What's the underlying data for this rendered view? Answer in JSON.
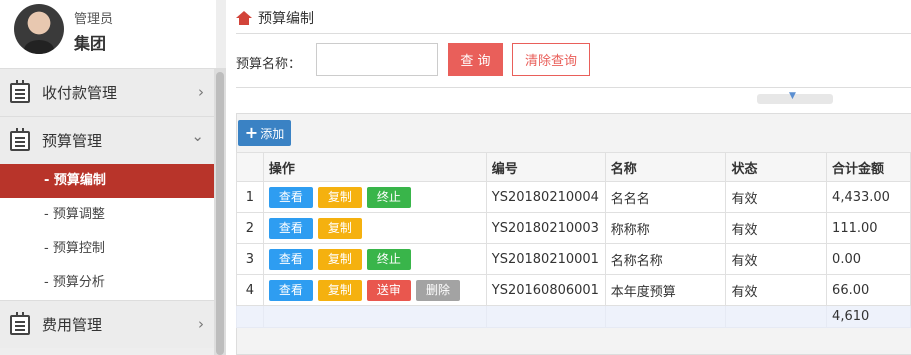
{
  "user": {
    "role": "管理员",
    "org": "集团"
  },
  "sidebar": {
    "groups": [
      {
        "label": "收付款管理",
        "chevron": "›"
      },
      {
        "label": "预算管理",
        "chevron": "⌄"
      },
      {
        "label": "费用管理",
        "chevron": "›"
      }
    ],
    "budget_items": [
      "- 预算编制",
      "- 预算调整",
      "- 预算控制",
      "- 预算分析"
    ],
    "active_item": "- 预算编制"
  },
  "page": {
    "title": "预算编制"
  },
  "search": {
    "label": "预算名称：",
    "value": "",
    "query_button": "查 询",
    "clear_button": "清除查询"
  },
  "toolbar": {
    "add_label": "添加"
  },
  "table": {
    "headers": [
      "操作",
      "编号",
      "名称",
      "状态",
      "合计金额"
    ],
    "rows": [
      {
        "no": "1",
        "actions": [
          "查看",
          "复制",
          "终止"
        ],
        "code": "YS20180210004",
        "name": "名名名",
        "status": "有效",
        "amount": "4,433.00"
      },
      {
        "no": "2",
        "actions": [
          "查看",
          "复制"
        ],
        "code": "YS20180210003",
        "name": "称称称",
        "status": "有效",
        "amount": "111.00"
      },
      {
        "no": "3",
        "actions": [
          "查看",
          "复制",
          "终止"
        ],
        "code": "YS20180210001",
        "name": "名称名称",
        "status": "有效",
        "amount": "0.00"
      },
      {
        "no": "4",
        "actions": [
          "查看",
          "复制",
          "送审",
          "删除"
        ],
        "code": "YS20160806001",
        "name": "本年度预算",
        "status": "有效",
        "amount": "66.00"
      }
    ],
    "total": "4,610"
  },
  "colors": {
    "accent_red": "#e95f5a",
    "active_menu": "#b8342a",
    "primary_blue": "#3a82c4"
  },
  "icons": {
    "home": "home-icon",
    "menu": "document-list-icon",
    "collapse": "triangle-down-icon"
  }
}
